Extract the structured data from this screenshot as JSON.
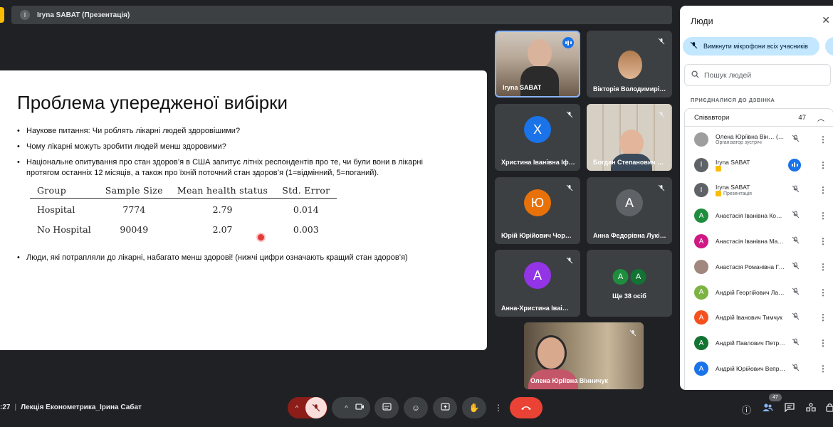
{
  "presenter_bar": {
    "icon": "I",
    "name": "Iryna SABAT (Презентація)"
  },
  "slide": {
    "title": "Проблема упередженої вибірки",
    "bullets": [
      "Наукове питання: Чи роблять лікарні людей здоровішими?",
      "Чому лікарні можуть зробити людей менш здоровими?",
      "Національне опитування про стан здоров’я в США запитує літніх респондентів про те, чи були вони в лікарні протягом останніх 12 місяців, а також про їхній поточний стан здоров’я (1=відмінний, 5=поганий)."
    ],
    "table": {
      "headers": [
        "Group",
        "Sample Size",
        "Mean health status",
        "Std. Error"
      ],
      "rows": [
        [
          "Hospital",
          "7774",
          "2.79",
          "0.014"
        ],
        [
          "No Hospital",
          "90049",
          "2.07",
          "0.003"
        ]
      ]
    },
    "conclusion": "Люди, які потрапляли до лікарні, набагато менш здорові! (нижчі цифри означають кращий стан здоров’я)"
  },
  "tiles": [
    {
      "name": "Iryna SABAT"
    },
    {
      "name": "Вікторія Володимирі…"
    },
    {
      "name": "Христина Іванівна Іф…",
      "initial": "Х",
      "color": "#1a73e8"
    },
    {
      "name": "Богдан Степанович С…"
    },
    {
      "name": "Юрій Юрійович Чорн…",
      "initial": "Ю",
      "color": "#e8710a"
    },
    {
      "name": "Анна Федорівна Лукі…",
      "initial": "А",
      "color": "#5f6368"
    },
    {
      "name": "Анна-Христина Іваі…",
      "initial": "А",
      "color": "#9334e6"
    },
    {
      "more_label": "Ще 38 осіб",
      "initials": [
        "А",
        "А"
      ],
      "colors": [
        "#1e8e3e",
        "#137333"
      ]
    },
    {
      "name": "Олена Юріївна Вінничук"
    }
  ],
  "panel": {
    "title": "Люди",
    "mute_all": "Вимкнути мікрофони всіх учасників",
    "search_placeholder": "Пошук людей",
    "section": "ПРИЄДНАЛИСЯ ДО ДЗВІНКА",
    "group_label": "Співавтори",
    "group_count": "47",
    "people": [
      {
        "name": "Олена Юріївна Він… (Ви)",
        "sub": "Організатор зустрічі",
        "initial": "",
        "color": "#9e9e9e"
      },
      {
        "name": "Iryna SABAT",
        "sub": "",
        "initial": "I",
        "color": "#5f6368"
      },
      {
        "name": "Iryna SABAT",
        "sub": "Презентація",
        "initial": "I",
        "color": "#5f6368"
      },
      {
        "name": "Анастасія Іванівна Кор…",
        "sub": "",
        "initial": "А",
        "color": "#1e8e3e"
      },
      {
        "name": "Анастасія Іванівна Мак…",
        "sub": "",
        "initial": "А",
        "color": "#d01884"
      },
      {
        "name": "Анастасія Романівна Га…",
        "sub": "",
        "initial": "",
        "color": "#a1887f"
      },
      {
        "name": "Андрій Георгійович Ла…",
        "sub": "",
        "initial": "А",
        "color": "#7cb342"
      },
      {
        "name": "Андрій Іванович Тимчук",
        "sub": "",
        "initial": "А",
        "color": "#f4511e"
      },
      {
        "name": "Андрій Павлович Петр…",
        "sub": "",
        "initial": "А",
        "color": "#137333"
      },
      {
        "name": "Андрій Юрійович Вепр…",
        "sub": "",
        "initial": "А",
        "color": "#1a73e8"
      }
    ]
  },
  "bottom": {
    "time": ":27",
    "meeting_title": "Лекція Економетрика_Ірина Сабат",
    "people_count": "47"
  }
}
